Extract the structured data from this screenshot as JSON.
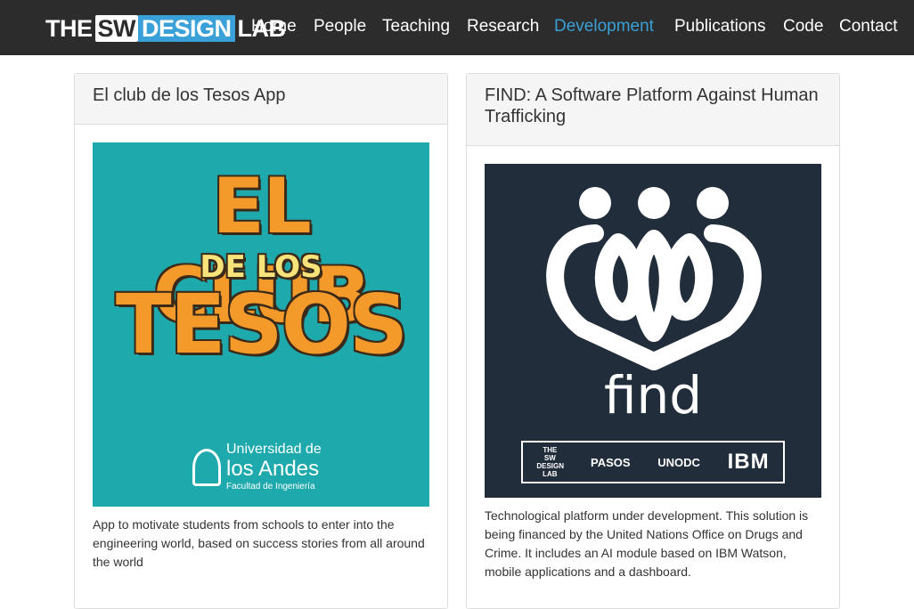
{
  "brand": {
    "the": "THE",
    "sw": "SW",
    "design": "DESIGN",
    "lab": "LAB"
  },
  "nav": {
    "items": [
      {
        "label": "Home"
      },
      {
        "label": "People"
      },
      {
        "label": "Teaching"
      },
      {
        "label": "Research"
      },
      {
        "label": "Development"
      },
      {
        "label": "Publications"
      },
      {
        "label": "Code"
      },
      {
        "label": "Contact"
      }
    ],
    "active": "Development"
  },
  "projects": [
    {
      "title": "El club de los Tesos App",
      "image": {
        "line1": "EL CLUB",
        "line2": "DE LOS",
        "line3": "TESOS",
        "uni_line1": "Universidad de",
        "uni_line2": "los Andes",
        "uni_line3": "Facultad de Ingeniería"
      },
      "description": "App to motivate students from schools to enter into the engineering world, based on success stories from all around the world"
    },
    {
      "title": "FIND: A Software Platform Against Human Trafficking",
      "image": {
        "word": "find",
        "partners": [
          "THE SW DESIGN LAB",
          "PASOS",
          "UNODC",
          "IBM"
        ]
      },
      "description": "Technological platform under development. This solution is being financed by the United Nations Office on Drugs and Crime. It includes an AI module based on IBM Watson, mobile applications and a dashboard."
    }
  ],
  "colors": {
    "navbar": "#2c2c2c",
    "accent": "#3aa0d8",
    "club_bg": "#1ea9ad",
    "find_bg": "#222d3b"
  }
}
